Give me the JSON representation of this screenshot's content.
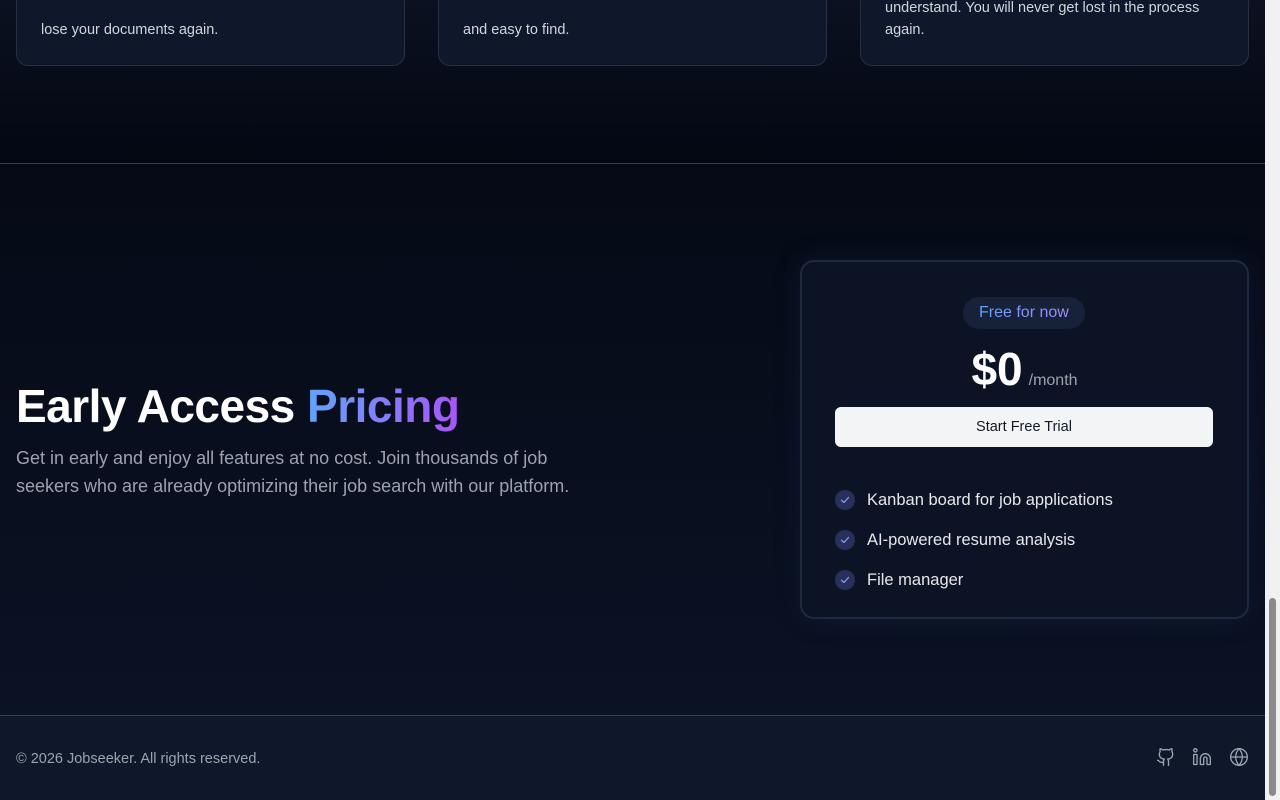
{
  "features": {
    "cards": [
      {
        "desc": "lose your documents again."
      },
      {
        "desc": "and easy to find."
      },
      {
        "desc": "understand. You will never get lost in the process again."
      }
    ]
  },
  "pricing": {
    "title_main": "Early Access",
    "title_accent": "Pricing",
    "subtitle": "Get in early and enjoy all features at no cost. Join thousands of job seekers who are already optimizing their job search with our platform.",
    "card": {
      "badge": "Free for now",
      "price": "$0",
      "period": "/month",
      "cta_label": "Start Free Trial",
      "features": [
        "Kanban board for job applications",
        "AI-powered resume analysis",
        "File manager"
      ]
    }
  },
  "footer": {
    "copyright": "© 2026 Jobseeker. All rights reserved.",
    "social": [
      {
        "icon": "github-icon"
      },
      {
        "icon": "linkedin-icon"
      },
      {
        "icon": "globe-icon"
      }
    ]
  },
  "colors": {
    "background": "#030712",
    "accent_start": "#60a5fa",
    "accent_end": "#a855f7",
    "card_bg": "#0c1324"
  }
}
